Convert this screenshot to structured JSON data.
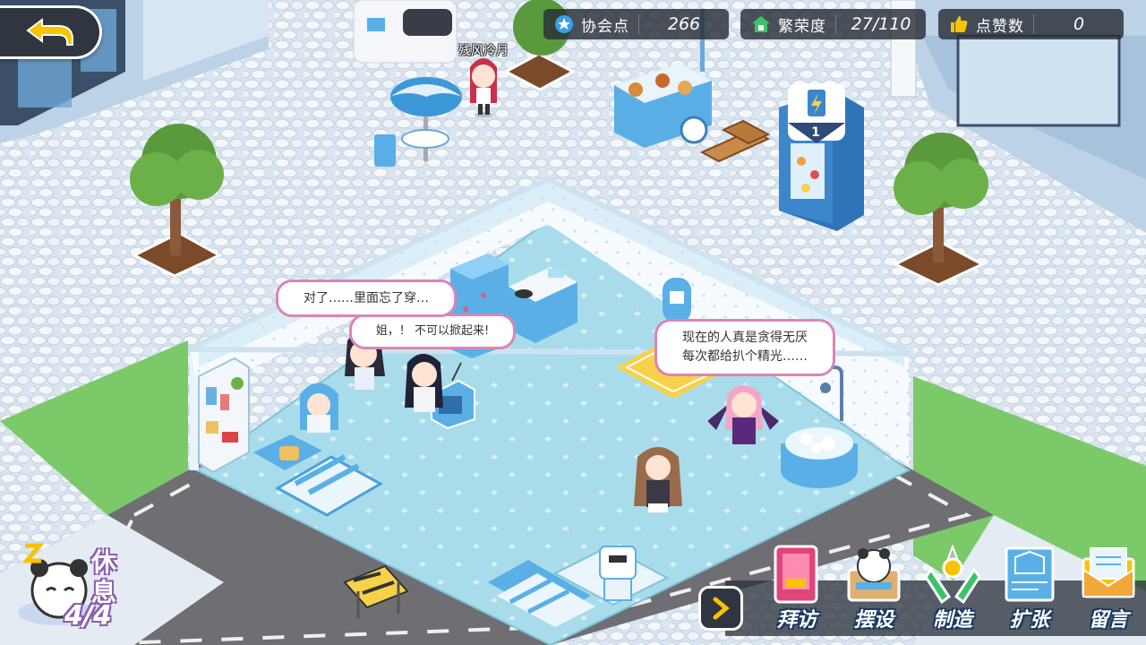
{
  "topbar": {
    "association_points": {
      "icon": "star-badge-icon",
      "label": "协会点",
      "value": "266"
    },
    "prosperity": {
      "icon": "house-icon",
      "label": "繁荣度",
      "value": "27/110"
    },
    "likes": {
      "icon": "thumbs-up-icon",
      "label": "点赞数",
      "value": "0"
    }
  },
  "npc_name": "残风冷月",
  "vending_badge": "1",
  "bubbles": {
    "left_top": "对了……里面忘了穿…",
    "left_bottom": "姐，！ 不可以掀起来!",
    "right_line1": "现在的人真是贪得无厌",
    "right_line2": "每次都给扒个精光……"
  },
  "rest": {
    "icon": "panda-sleep-icon",
    "char1": "休",
    "char2": "息",
    "count": "4/4"
  },
  "menu": {
    "expand_icon": "chevron-right-icon",
    "items": [
      {
        "icon": "door-icon",
        "label": "拜访"
      },
      {
        "icon": "furniture-panda-icon",
        "label": "摆设"
      },
      {
        "icon": "wrench-icon",
        "label": "制造"
      },
      {
        "icon": "blueprint-icon",
        "label": "扩张"
      },
      {
        "icon": "envelope-icon",
        "label": "留言"
      }
    ]
  },
  "colors": {
    "accent_pink": "#d985b8",
    "floor": "#a8dbe8",
    "pavement": "#e4ebf3",
    "grass": "#7cc96a",
    "road": "#6f6f73",
    "hud_dark": "#2f3640"
  }
}
